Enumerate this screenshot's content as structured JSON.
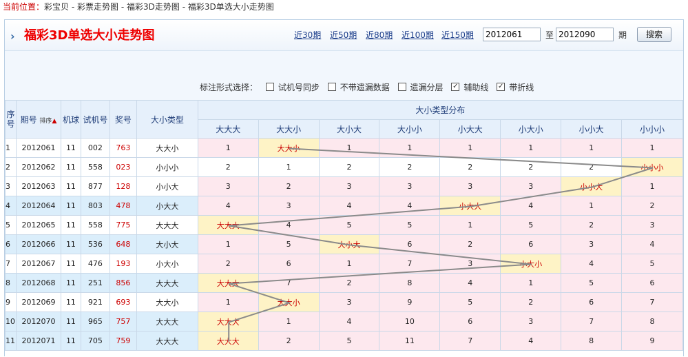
{
  "breadcrumb": {
    "label": "当前位置：",
    "items": [
      "彩宝贝",
      "彩票走势图",
      "福彩3D走势图",
      "福彩3D单选大小走势图"
    ],
    "separator": " - "
  },
  "header": {
    "title": "福彩3D单选大小走势图",
    "quick_links": [
      "近30期",
      "近50期",
      "近80期",
      "近100期",
      "近150期"
    ],
    "from_value": "2012061",
    "to_label": "至",
    "to_value": "2012090",
    "period_label": "期",
    "search_label": "搜索"
  },
  "options": {
    "label": "标注形式选择：",
    "items": [
      {
        "label": "试机号同步",
        "checked": false
      },
      {
        "label": "不带遗漏数据",
        "checked": false
      },
      {
        "label": "遗漏分层",
        "checked": false
      },
      {
        "label": "辅助线",
        "checked": true
      },
      {
        "label": "带折线",
        "checked": true
      }
    ]
  },
  "table": {
    "headers": {
      "seq": "序号",
      "issue": "期号",
      "sort": "排序",
      "ball": "机球",
      "test": "试机号",
      "prize": "奖号",
      "type": "大小类型",
      "dist_group": "大小类型分布"
    },
    "categories": [
      "大大大",
      "大大小",
      "大小大",
      "大小小",
      "小大大",
      "小大小",
      "小小大",
      "小小小"
    ],
    "rows": [
      {
        "seq": "1",
        "issue": "2012061",
        "ball": "11",
        "test": "002",
        "prize": "763",
        "type": "大大小",
        "hit": 1,
        "miss": [
          "1",
          "",
          "1",
          "1",
          "1",
          "1",
          "1",
          "1"
        ]
      },
      {
        "seq": "2",
        "issue": "2012062",
        "ball": "11",
        "test": "558",
        "prize": "023",
        "type": "小小小",
        "hit": 7,
        "miss": [
          "2",
          "1",
          "2",
          "2",
          "2",
          "2",
          "2",
          ""
        ]
      },
      {
        "seq": "3",
        "issue": "2012063",
        "ball": "11",
        "test": "877",
        "prize": "128",
        "type": "小小大",
        "hit": 6,
        "miss": [
          "3",
          "2",
          "3",
          "3",
          "3",
          "3",
          "",
          "1"
        ]
      },
      {
        "seq": "4",
        "issue": "2012064",
        "ball": "11",
        "test": "803",
        "prize": "478",
        "type": "小大大",
        "hit": 4,
        "miss": [
          "4",
          "3",
          "4",
          "4",
          "",
          "4",
          "1",
          "2"
        ]
      },
      {
        "seq": "5",
        "issue": "2012065",
        "ball": "11",
        "test": "558",
        "prize": "775",
        "type": "大大大",
        "hit": 0,
        "miss": [
          "",
          "4",
          "5",
          "5",
          "1",
          "5",
          "2",
          "3"
        ]
      },
      {
        "seq": "6",
        "issue": "2012066",
        "ball": "11",
        "test": "536",
        "prize": "648",
        "type": "大小大",
        "hit": 2,
        "miss": [
          "1",
          "5",
          "",
          "6",
          "2",
          "6",
          "3",
          "4"
        ]
      },
      {
        "seq": "7",
        "issue": "2012067",
        "ball": "11",
        "test": "476",
        "prize": "193",
        "type": "小大小",
        "hit": 5,
        "miss": [
          "2",
          "6",
          "1",
          "7",
          "3",
          "",
          "4",
          "5"
        ]
      },
      {
        "seq": "8",
        "issue": "2012068",
        "ball": "11",
        "test": "251",
        "prize": "856",
        "type": "大大大",
        "hit": 0,
        "miss": [
          "",
          "7",
          "2",
          "8",
          "4",
          "1",
          "5",
          "6"
        ]
      },
      {
        "seq": "9",
        "issue": "2012069",
        "ball": "11",
        "test": "921",
        "prize": "693",
        "type": "大大小",
        "hit": 1,
        "miss": [
          "1",
          "",
          "3",
          "9",
          "5",
          "2",
          "6",
          "7"
        ]
      },
      {
        "seq": "10",
        "issue": "2012070",
        "ball": "11",
        "test": "965",
        "prize": "757",
        "type": "大大大",
        "hit": 0,
        "miss": [
          "",
          "1",
          "4",
          "10",
          "6",
          "3",
          "7",
          "8"
        ]
      },
      {
        "seq": "11",
        "issue": "2012071",
        "ball": "11",
        "test": "705",
        "prize": "759",
        "type": "大大大",
        "hit": 0,
        "miss": [
          "",
          "2",
          "5",
          "11",
          "7",
          "4",
          "8",
          "9"
        ]
      }
    ]
  },
  "colors": {
    "title": "#e00000",
    "link": "#1a3c8a",
    "header_bg": "#e6f0fb",
    "row_blue": "#dbeefb",
    "dist_pink": "#fde8ee",
    "hit_yellow": "#fef3c6",
    "trend_line": "#8a8a8a"
  }
}
